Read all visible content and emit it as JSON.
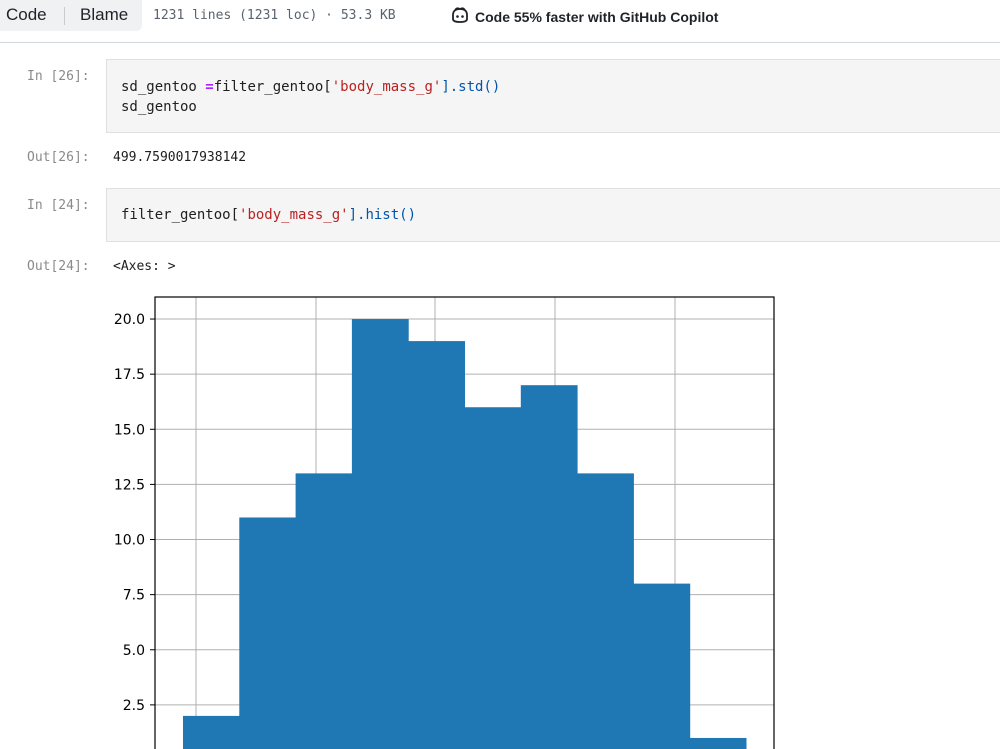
{
  "toolbar": {
    "code_label": "Code",
    "blame_label": "Blame",
    "file_info": "1231 lines (1231 loc) · 53.3 KB",
    "copilot_label": "Code 55% faster with GitHub Copilot"
  },
  "cells": [
    {
      "in_prompt": "In [26]:",
      "code_lines": [
        [
          {
            "t": "sd_gentoo ",
            "c": ""
          },
          {
            "t": "=",
            "c": "op"
          },
          {
            "t": "filter_gentoo[",
            "c": ""
          },
          {
            "t": "'body_mass_g'",
            "c": "s"
          },
          {
            "t": "].std()",
            "c": "fn"
          }
        ],
        [
          {
            "t": "sd_gentoo",
            "c": ""
          }
        ]
      ],
      "out_prompt": "Out[26]:",
      "output": "499.7590017938142"
    },
    {
      "in_prompt": "In [24]:",
      "code_lines": [
        [
          {
            "t": "filter_gentoo[",
            "c": ""
          },
          {
            "t": "'body_mass_g'",
            "c": "s"
          },
          {
            "t": "].hist()",
            "c": "fn"
          }
        ]
      ],
      "out_prompt": "Out[24]:",
      "output": "<Axes: >"
    }
  ],
  "chart_data": {
    "type": "bar",
    "title": "",
    "xlabel": "",
    "ylabel": "",
    "bar_color": "#1f77b4",
    "grid": true,
    "values": [
      2,
      11,
      13,
      20,
      19,
      16,
      17,
      13,
      8,
      1
    ],
    "ytick_labels": [
      "2.5",
      "5.0",
      "7.5",
      "10.0",
      "12.5",
      "15.0",
      "17.5",
      "20.0"
    ],
    "ytick_values": [
      2.5,
      5.0,
      7.5,
      10.0,
      12.5,
      15.0,
      17.5,
      20.0
    ],
    "ylim": [
      0,
      21
    ]
  }
}
